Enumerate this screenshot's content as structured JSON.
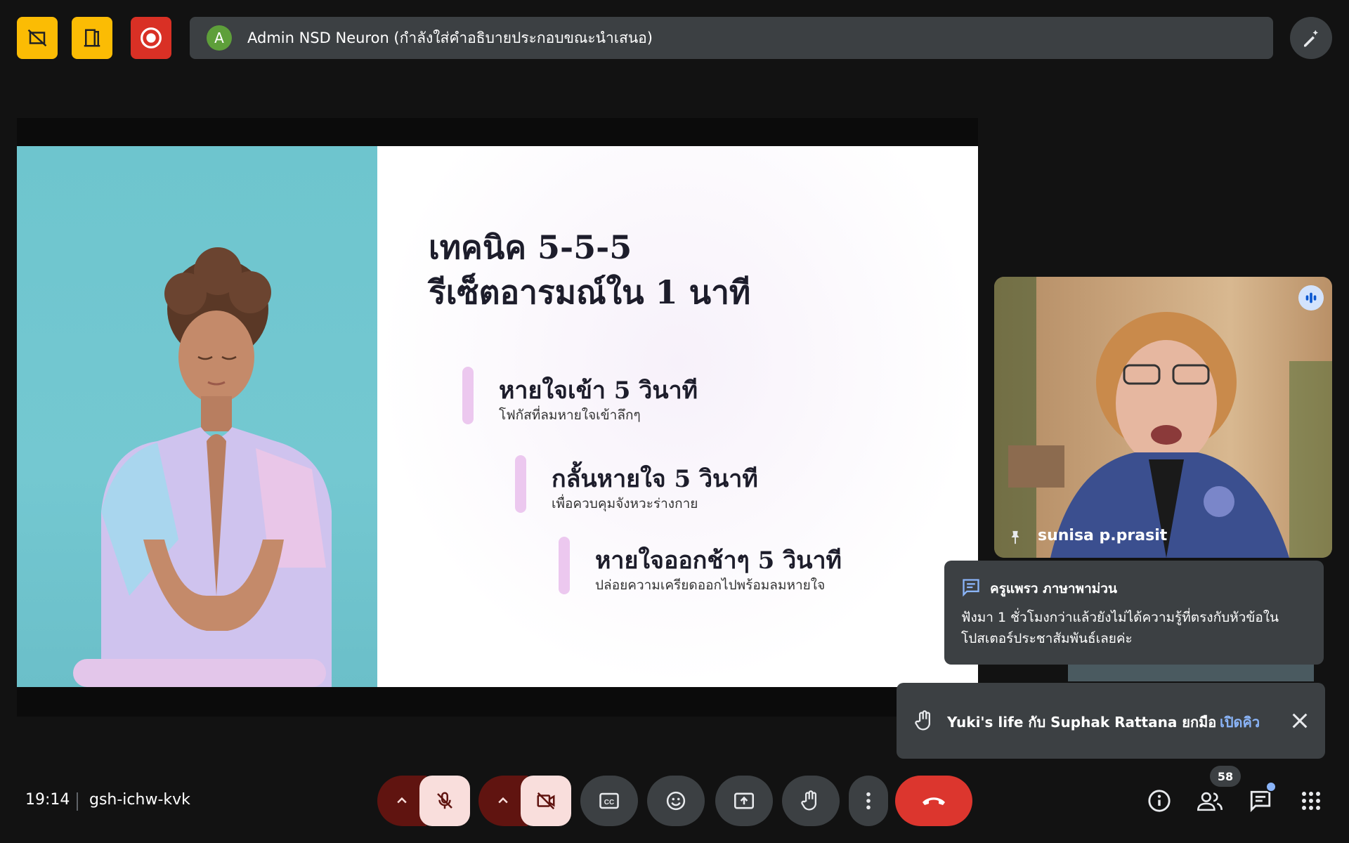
{
  "topbar": {
    "presenter_initial": "A",
    "presenter_text": "Admin NSD Neuron (กำลังใส่คำอธิบายประกอบขณะนำเสนอ)"
  },
  "slide": {
    "title_line1": "เทคนิค 5-5-5",
    "title_line2": "รีเซ็ตอารมณ์ใน 1 นาที",
    "steps": [
      {
        "heading": "หายใจเข้า 5 วินาที",
        "sub": "โฟกัสที่ลมหายใจเข้าลึกๆ"
      },
      {
        "heading": "กลั้นหายใจ 5 วินาที",
        "sub": "เพื่อควบคุมจังหวะร่างกาย"
      },
      {
        "heading": "หายใจออกช้าๆ 5 วินาที",
        "sub": "ปล่อยความเครียดออกไปพร้อมลมหายใจ"
      }
    ]
  },
  "participant": {
    "name": "sunisa p.prasit"
  },
  "chat_notification": {
    "sender": "ครูแพรว ภาษาพาม่วน",
    "message": "ฟังมา 1 ชั่วโมงกว่าแล้วยังไม่ได้ความรู้ที่ตรงกับหัวข้อในโปสเตอร์ประชาสัมพันธ์เลยค่ะ"
  },
  "hand_notification": {
    "text": "Yuki's life กับ Suphak Rattana ยกมือ",
    "link": "เปิดคิว"
  },
  "bottombar": {
    "time": "19:14",
    "meeting_code": "gsh-ichw-kvk",
    "participant_count": "58"
  },
  "colors": {
    "yellow": "#fbbc04",
    "red": "#d93025",
    "end_call": "#dc362e",
    "link": "#8ab4f8"
  }
}
